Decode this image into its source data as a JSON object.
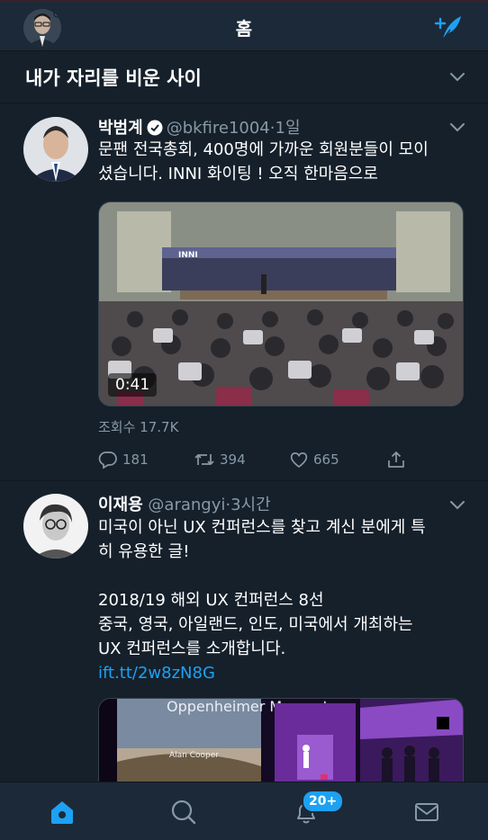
{
  "header": {
    "title": "홈"
  },
  "section": {
    "title": "내가 자리를 비운 사이"
  },
  "tweets": [
    {
      "name": "박범계",
      "verified": true,
      "handle": "@bkfire1004",
      "separator": "·",
      "time": "1일",
      "text_lines": [
        "문팬 전국총회, 400명에 가까운 회원분들이 모이",
        "셨습니다. INNI 화이팅 ! 오직 한마음으로"
      ],
      "media": {
        "type": "video",
        "duration": "0:41",
        "banner_text": "INNI"
      },
      "views": "조회수 17.7K",
      "replies": "181",
      "retweets": "394",
      "likes": "665"
    },
    {
      "name": "이재용",
      "handle": "@arangyi",
      "separator": "·",
      "time": "3시간",
      "text_lines": [
        "미국이 아닌 UX 컨퍼런스를 찾고 계신 분에게 특",
        "히 유용한 글!",
        "",
        "2018/19 해외 UX 컨퍼런스 8선",
        "중국, 영국, 아일랜드, 인도, 미국에서 개최하는",
        "UX 컨퍼런스를 소개합니다."
      ],
      "link": "ift.tt/2w8zN8G",
      "media": {
        "type": "image",
        "slide_title": "Oppenheimer Moment",
        "slide_author": "Alan Cooper"
      }
    }
  ],
  "nav": {
    "badge": "20+"
  },
  "colors": {
    "background": "#15202b",
    "bar": "#1c2938",
    "accent": "#1da1f2",
    "muted": "#8899a6"
  },
  "icons": [
    "compose-icon",
    "chevron-down-icon",
    "verified-icon",
    "reply-icon",
    "retweet-icon",
    "like-icon",
    "share-icon",
    "home-icon",
    "search-icon",
    "notifications-icon",
    "messages-icon"
  ]
}
